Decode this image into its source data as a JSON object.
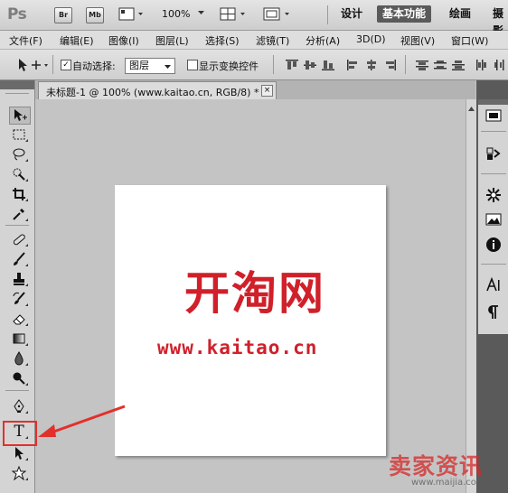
{
  "app": {
    "logo": "Ps",
    "bridge_label": "Br",
    "minibridge_label": "Mb",
    "zoom": "100%",
    "workspaces": [
      "设计",
      "基本功能",
      "绘画",
      "摄影"
    ],
    "active_workspace": "基本功能"
  },
  "menubar": {
    "items": [
      "文件(F)",
      "编辑(E)",
      "图像(I)",
      "图层(L)",
      "选择(S)",
      "滤镜(T)",
      "分析(A)",
      "3D(D)",
      "视图(V)",
      "窗口(W)"
    ]
  },
  "options": {
    "auto_select_label": "自动选择:",
    "auto_select_checked": true,
    "auto_select_value": "图层",
    "show_transform_label": "显示变换控件",
    "show_transform_checked": false
  },
  "document": {
    "tab_title": "未标题-1 @ 100% (www.kaitao.cn, RGB/8) *",
    "close_symbol": "×",
    "canvas_text": "开淘网",
    "canvas_url": "www.kaitao.cn"
  },
  "tools": [
    "move-icon",
    "marquee-icon",
    "lasso-icon",
    "quick-select-icon",
    "crop-icon",
    "eyedropper-icon",
    "healing-icon",
    "brush-icon",
    "stamp-icon",
    "history-brush-icon",
    "eraser-icon",
    "gradient-icon",
    "blur-icon",
    "dodge-icon",
    "pen-icon",
    "type-icon",
    "path-select-icon",
    "shape-icon"
  ],
  "type_tool_glyph": "T",
  "watermark": {
    "text": "卖家资讯",
    "url": "www.maijia.com"
  },
  "colors": {
    "accent_red": "#e2302b",
    "canvas_text_red": "#d0202a",
    "active_workspace_bg": "#5a5a5a"
  }
}
